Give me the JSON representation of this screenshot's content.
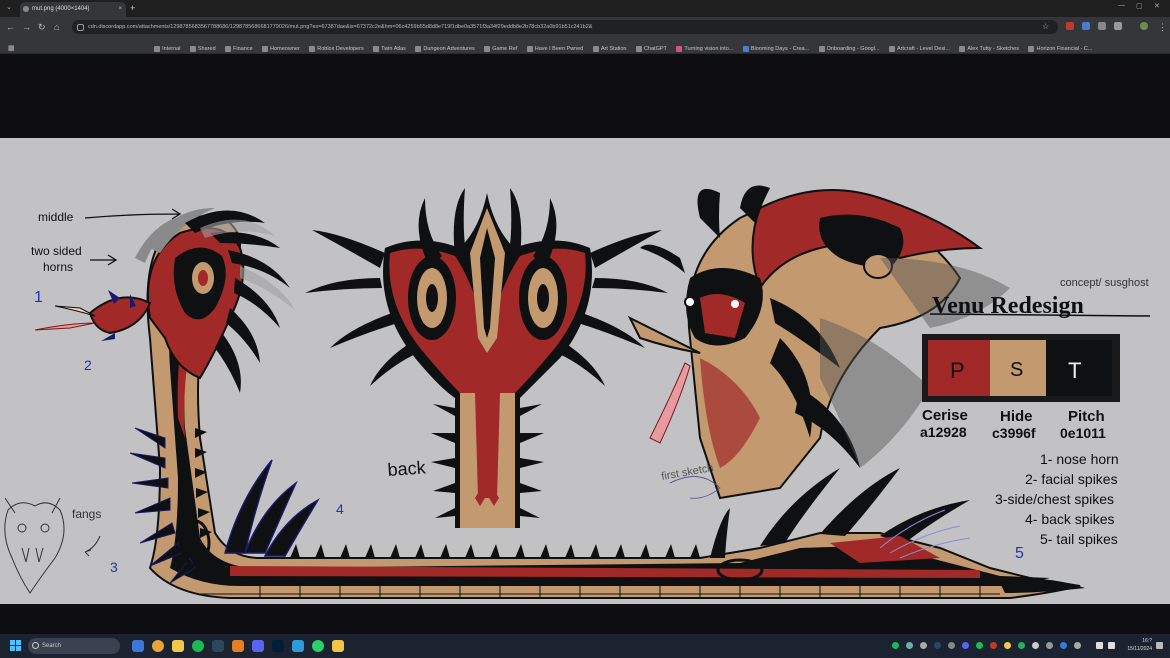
{
  "browser": {
    "tab_title": "mut.png (4000×1404)",
    "url": "cdn.discordapp.com/attachments/1298785683567788686/1298785686681779026/mut.png?ex=67387dae&is=67372c2e&hm=06c4259b55d8d8e719f1dbe0a3571f3a34f29eddb8e2b78cb32a0b91b51c241b2&",
    "bookmarks": [
      "Internal",
      "Shared",
      "Finance",
      "Homeowner",
      "Roblox Developers",
      "Twin Atlas",
      "Dungeon Adventures",
      "Game Ref",
      "Have I Been Pwned",
      "Art Station",
      "ChatGPT",
      "Turning vision into...",
      "Blooming Days - Crea...",
      "Onboarding - Googl...",
      "Artcraft - Level Desi...",
      "Alex Tutty - Sketches",
      "Horizon Financial - C..."
    ]
  },
  "artwork": {
    "annotations": {
      "middle": "middle",
      "two_sided_horns": "two sided horns",
      "back": "back",
      "fangs": "fangs",
      "first_sketch": "first sketch",
      "credit": "concept/ susghost",
      "n1": "1",
      "n2": "2",
      "n3": "3",
      "n4": "4",
      "n5": "5"
    },
    "title": "Venu Redesign",
    "palette": [
      {
        "name": "Cerise",
        "hex_label": "a12928",
        "glyph": "P",
        "color": "#a12928"
      },
      {
        "name": "Hide",
        "hex_label": "c3996f",
        "glyph": "S",
        "color": "#c3996f"
      },
      {
        "name": "Pitch",
        "hex_label": "0e1011",
        "glyph": "T",
        "color": "#0e1011"
      }
    ],
    "legend": [
      "1- nose horn",
      "2- facial spikes",
      "3-side/chest spikes",
      "4- back spikes",
      "5- tail spikes"
    ]
  },
  "taskbar": {
    "search_placeholder": "Search",
    "time": "16:?",
    "date": "15/11/2024"
  }
}
